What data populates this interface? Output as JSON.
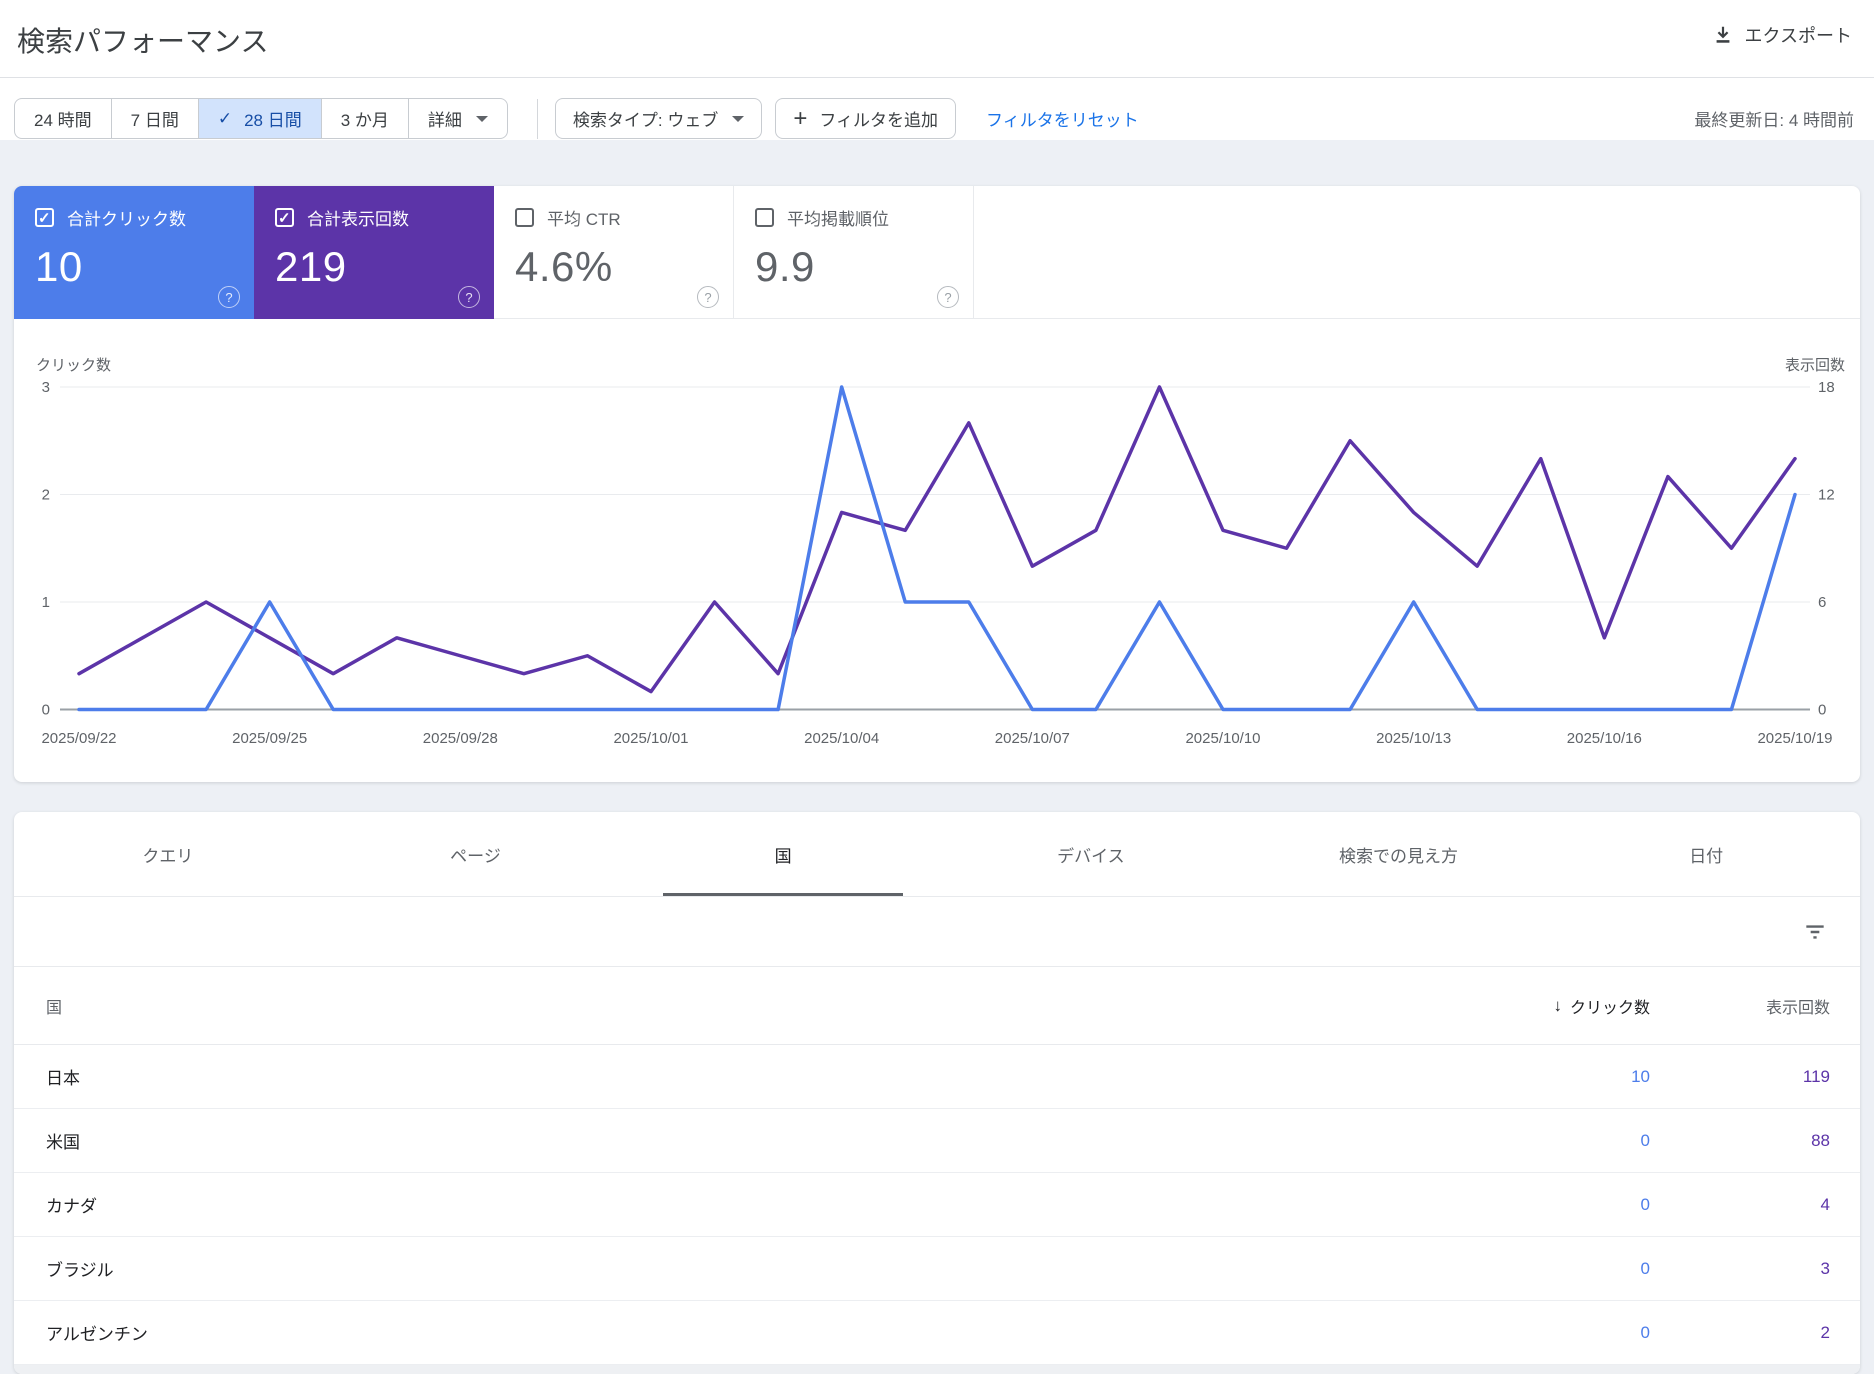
{
  "header": {
    "title": "検索パフォーマンス",
    "export_label": "エクスポート"
  },
  "filters": {
    "date_ranges": [
      {
        "label": "24 時間",
        "selected": false
      },
      {
        "label": "7 日間",
        "selected": false
      },
      {
        "label": "28 日間",
        "selected": true
      },
      {
        "label": "3 か月",
        "selected": false
      },
      {
        "label": "詳細",
        "selected": false,
        "has_dropdown": true
      }
    ],
    "search_type": "検索タイプ: ウェブ",
    "add_filter": "フィルタを追加",
    "reset_filters": "フィルタをリセット",
    "last_updated": "最終更新日: 4 時間前"
  },
  "metrics": [
    {
      "label": "合計クリック数",
      "value": "10",
      "checked": true,
      "bg": "#4d7dea",
      "fg": "#ffffff"
    },
    {
      "label": "合計表示回数",
      "value": "219",
      "checked": true,
      "bg": "#5c34a8",
      "fg": "#ffffff"
    },
    {
      "label": "平均 CTR",
      "value": "4.6%",
      "checked": false
    },
    {
      "label": "平均掲載順位",
      "value": "9.9",
      "checked": false
    }
  ],
  "colors": {
    "clicks": "#4d7dea",
    "impressions": "#5c34a8",
    "link": "#1a73e8",
    "grid": "#e9ebee",
    "zero_line": "#9aa0a6",
    "axis_text": "#5f6368"
  },
  "chart_data": {
    "type": "line",
    "x": [
      "2025/09/22",
      "2025/09/23",
      "2025/09/24",
      "2025/09/25",
      "2025/09/26",
      "2025/09/27",
      "2025/09/28",
      "2025/09/29",
      "2025/09/30",
      "2025/10/01",
      "2025/10/02",
      "2025/10/03",
      "2025/10/04",
      "2025/10/05",
      "2025/10/06",
      "2025/10/07",
      "2025/10/08",
      "2025/10/09",
      "2025/10/10",
      "2025/10/11",
      "2025/10/12",
      "2025/10/13",
      "2025/10/14",
      "2025/10/15",
      "2025/10/16",
      "2025/10/17",
      "2025/10/18",
      "2025/10/19"
    ],
    "x_tick_every": 3,
    "series": [
      {
        "name": "クリック数",
        "axis": "left",
        "values": [
          0,
          0,
          0,
          1,
          0,
          0,
          0,
          0,
          0,
          0,
          0,
          0,
          3,
          1,
          1,
          0,
          0,
          1,
          0,
          0,
          0,
          1,
          0,
          0,
          0,
          0,
          0,
          2
        ]
      },
      {
        "name": "表示回数",
        "axis": "right",
        "values": [
          2,
          4,
          6,
          4,
          2,
          4,
          3,
          2,
          3,
          1,
          6,
          2,
          11,
          10,
          16,
          8,
          10,
          18,
          10,
          9,
          15,
          11,
          8,
          14,
          4,
          13,
          9,
          14
        ]
      }
    ],
    "left_axis": {
      "label": "クリック数",
      "ticks": [
        0,
        1,
        2,
        3
      ],
      "max": 3
    },
    "right_axis": {
      "label": "表示回数",
      "ticks": [
        0,
        6,
        12,
        18
      ],
      "max": 18
    },
    "grid": true,
    "legend_position": "none"
  },
  "tabs": [
    {
      "label": "クエリ",
      "selected": false
    },
    {
      "label": "ページ",
      "selected": false
    },
    {
      "label": "国",
      "selected": true
    },
    {
      "label": "デバイス",
      "selected": false
    },
    {
      "label": "検索での見え方",
      "selected": false
    },
    {
      "label": "日付",
      "selected": false
    }
  ],
  "table": {
    "columns": {
      "dimension": "国",
      "clicks": "クリック数",
      "impressions": "表示回数"
    },
    "sorted_by": "クリック数",
    "rows": [
      {
        "country": "日本",
        "clicks": "10",
        "impressions": "119"
      },
      {
        "country": "米国",
        "clicks": "0",
        "impressions": "88"
      },
      {
        "country": "カナダ",
        "clicks": "0",
        "impressions": "4"
      },
      {
        "country": "ブラジル",
        "clicks": "0",
        "impressions": "3"
      },
      {
        "country": "アルゼンチン",
        "clicks": "0",
        "impressions": "2"
      }
    ]
  }
}
